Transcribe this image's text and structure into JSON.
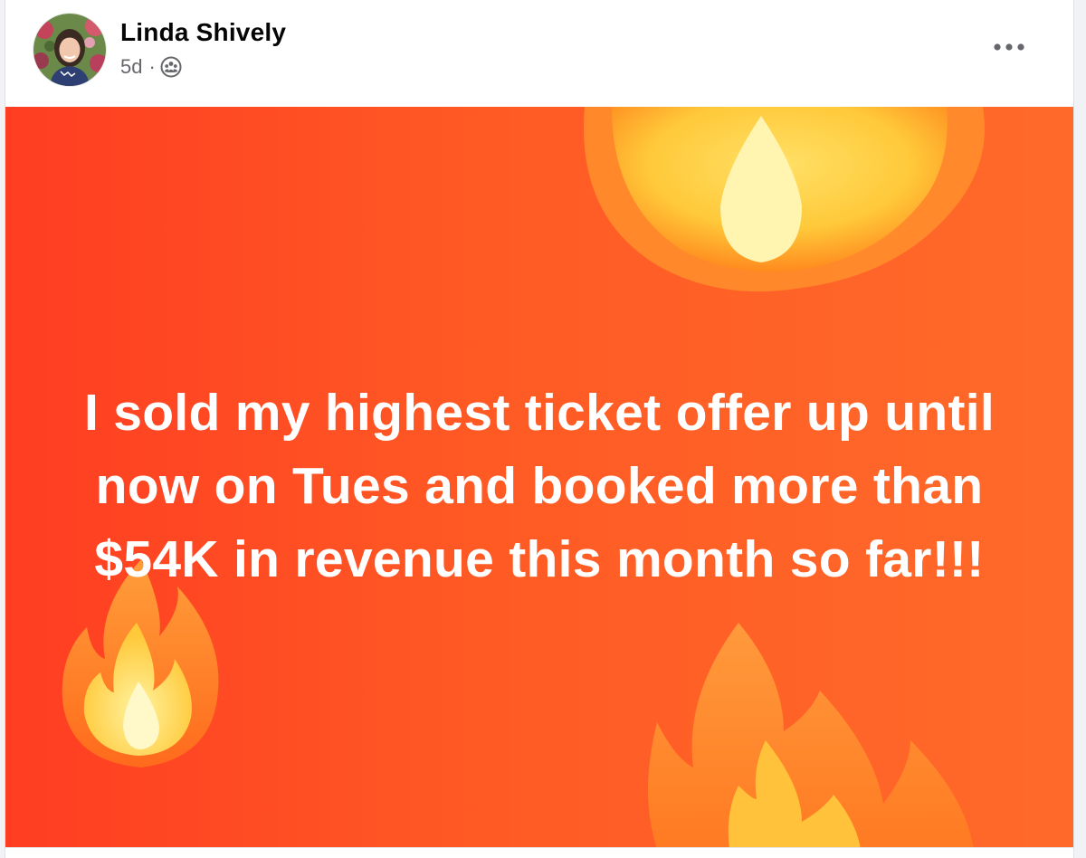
{
  "post": {
    "author": "Linda Shively",
    "timestamp": "5d",
    "separator": "·",
    "audience_icon": "friends-icon",
    "more_icon": "more-options-icon",
    "image_text_lines": [
      "I sold my highest ticket offer up until",
      "now on Tues and booked more than",
      "$54K in revenue this month so far!!!"
    ]
  },
  "colors": {
    "background_orange": "#ff5a24",
    "text_white": "#ffffff",
    "author_text": "#050505",
    "meta_text": "#65676b"
  }
}
